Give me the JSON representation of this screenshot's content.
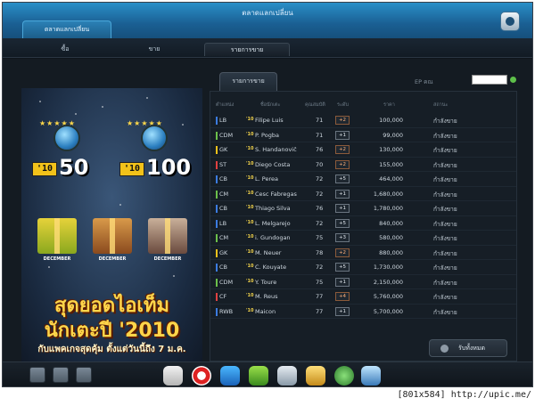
{
  "window": {
    "title": "ตลาดแลกเปลี่ยน"
  },
  "main_tab": {
    "label": "ตลาดแลกเปลี่ยน"
  },
  "subnav": [
    {
      "label": "ซื้อ",
      "active": false
    },
    {
      "label": "ขาย",
      "active": false
    },
    {
      "label": "รายการขาย",
      "active": true
    }
  ],
  "list_tab": {
    "label": "รายการขาย"
  },
  "ep": {
    "label": "EP คณ",
    "value": ""
  },
  "banner": {
    "badge1_chip": "'10",
    "badge1_num": "50",
    "badge2_chip": "'10",
    "badge2_num": "100",
    "gift_label": "DECEMBER",
    "line1": "สุดยอดไอเท็ม",
    "line2": "นักเตะปี '2010",
    "line3": "กับแพคเกจสุดคุ้ม ตั้งแต่วันนี้ถึง 7 ม.ค."
  },
  "table": {
    "headers": [
      "ตำแหน่ง",
      "ชื่อนักเตะ",
      "คุณสมบัติ",
      "ระดับ",
      "ราคา",
      "สถานะ"
    ],
    "rows": [
      {
        "pos": "LB",
        "pos_color": "#3b7be0",
        "season": "'10",
        "name": "Filipe Luis",
        "ovr": "71",
        "grade": "+2",
        "price": "100,000",
        "status": "กำลังขาย"
      },
      {
        "pos": "CDM",
        "pos_color": "#6bc04a",
        "season": "'10",
        "name": "P. Pogba",
        "ovr": "71",
        "grade": "+1",
        "price": "99,000",
        "status": "กำลังขาย"
      },
      {
        "pos": "GK",
        "pos_color": "#f2c21a",
        "season": "'10",
        "name": "S. Handanovič",
        "ovr": "76",
        "grade": "+2",
        "price": "130,000",
        "status": "กำลังขาย"
      },
      {
        "pos": "ST",
        "pos_color": "#e04040",
        "season": "'10",
        "name": "Diego Costa",
        "ovr": "70",
        "grade": "+2",
        "price": "155,000",
        "status": "กำลังขาย"
      },
      {
        "pos": "CB",
        "pos_color": "#3b7be0",
        "season": "'10",
        "name": "L. Perea",
        "ovr": "72",
        "grade": "+5",
        "price": "464,000",
        "status": "กำลังขาย"
      },
      {
        "pos": "CM",
        "pos_color": "#6bc04a",
        "season": "'10",
        "name": "Cesc Fabregas",
        "ovr": "72",
        "grade": "+1",
        "price": "1,680,000",
        "status": "กำลังขาย"
      },
      {
        "pos": "CB",
        "pos_color": "#3b7be0",
        "season": "'10",
        "name": "Thiago Silva",
        "ovr": "76",
        "grade": "+1",
        "price": "1,780,000",
        "status": "กำลังขาย"
      },
      {
        "pos": "LB",
        "pos_color": "#3b7be0",
        "season": "'10",
        "name": "L. Melgarejo",
        "ovr": "72",
        "grade": "+5",
        "price": "840,000",
        "status": "กำลังขาย"
      },
      {
        "pos": "CM",
        "pos_color": "#6bc04a",
        "season": "'10",
        "name": "i. Gundogan",
        "ovr": "75",
        "grade": "+3",
        "price": "580,000",
        "status": "กำลังขาย"
      },
      {
        "pos": "GK",
        "pos_color": "#f2c21a",
        "season": "'10",
        "name": "M. Neuer",
        "ovr": "78",
        "grade": "+2",
        "price": "880,000",
        "status": "กำลังขาย"
      },
      {
        "pos": "CB",
        "pos_color": "#3b7be0",
        "season": "'10",
        "name": "C. Kouyate",
        "ovr": "72",
        "grade": "+5",
        "price": "1,730,000",
        "status": "กำลังขาย"
      },
      {
        "pos": "CDM",
        "pos_color": "#6bc04a",
        "season": "'10",
        "name": "Y. Toure",
        "ovr": "75",
        "grade": "+1",
        "price": "2,150,000",
        "status": "กำลังขาย"
      },
      {
        "pos": "CF",
        "pos_color": "#e04040",
        "season": "'10",
        "name": "M. Reus",
        "ovr": "77",
        "grade": "+4",
        "price": "5,760,000",
        "status": "กำลังขาย"
      },
      {
        "pos": "RWB",
        "pos_color": "#3b7be0",
        "season": "'10",
        "name": "Maicon",
        "ovr": "77",
        "grade": "+1",
        "price": "5,700,000",
        "status": "กำลังขาย"
      }
    ]
  },
  "bulk_button": {
    "label": "รับทั้งหมด"
  },
  "footer_note": "[801x584] http://upic.me/"
}
